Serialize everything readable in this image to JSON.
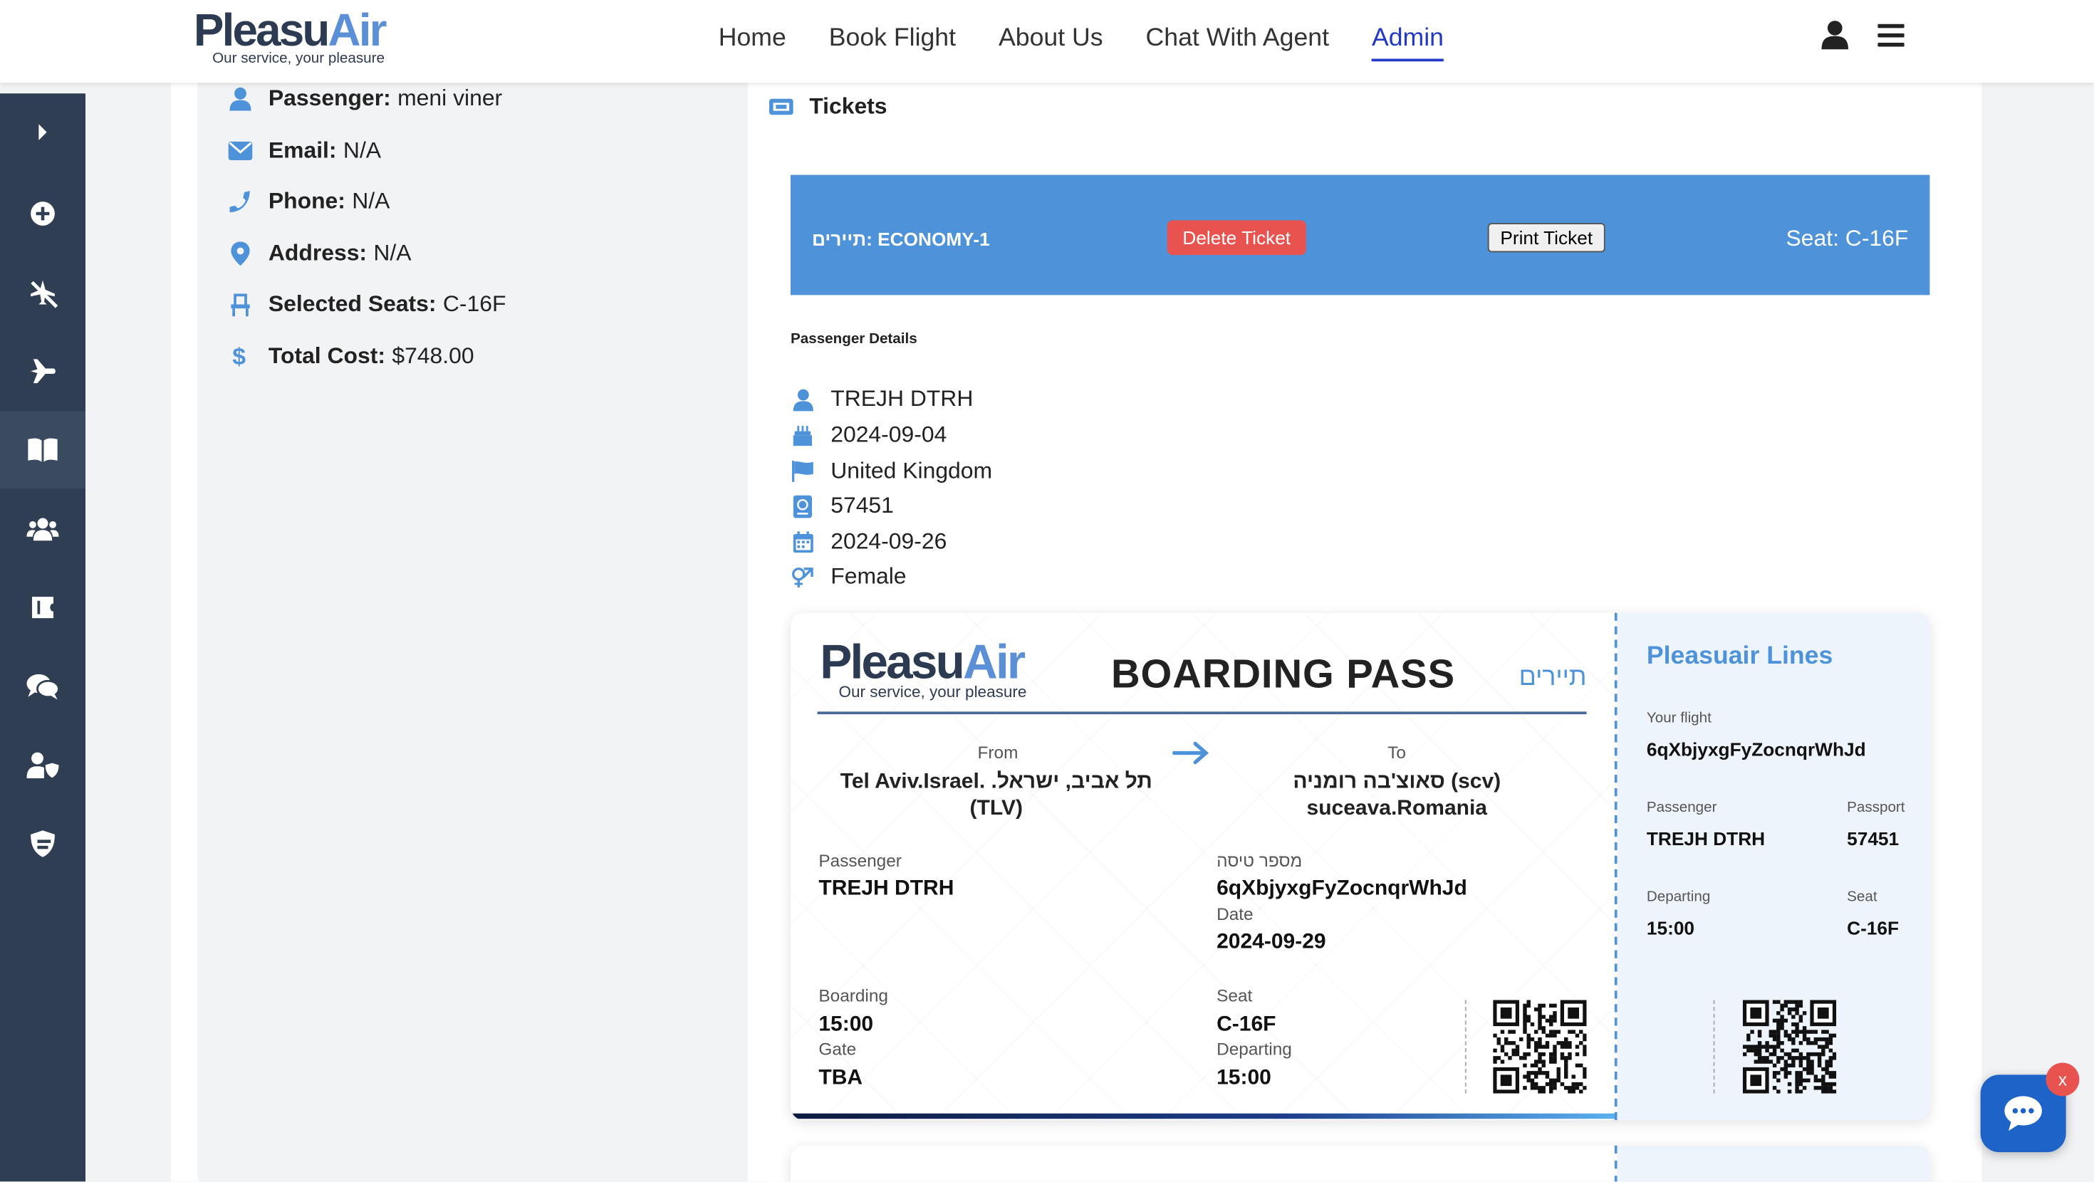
{
  "brand": {
    "name_main": "Pleasu",
    "name_accent": "Air",
    "tagline": "Our service, your pleasure"
  },
  "nav": {
    "items": [
      "Home",
      "Book Flight",
      "About Us",
      "Chat With Agent",
      "Admin"
    ],
    "active": "Admin"
  },
  "booking_info": {
    "passenger_label": "Passenger:",
    "passenger_value": "meni viner",
    "email_label": "Email:",
    "email_value": "N/A",
    "phone_label": "Phone:",
    "phone_value": "N/A",
    "address_label": "Address:",
    "address_value": "N/A",
    "seats_label": "Selected Seats:",
    "seats_value": "C-16F",
    "cost_label": "Total Cost:",
    "cost_value": "$748.00"
  },
  "tickets": {
    "heading": "Tickets",
    "bar": {
      "class_label": "תיירים: ECONOMY-1",
      "delete_label": "Delete Ticket",
      "print_label": "Print Ticket",
      "seat_label": "Seat: C-16F"
    },
    "passenger_details_title": "Passenger Details",
    "passenger_details": {
      "name": "TREJH DTRH",
      "birth_date": "2024-09-04",
      "country": "United Kingdom",
      "passport": "57451",
      "date": "2024-09-26",
      "gender": "Female"
    }
  },
  "boarding_pass": {
    "title": "BOARDING PASS",
    "class_hebrew": "תיירים",
    "from_label": "From",
    "from_city": "תל אביב, ישראל. Tel Aviv.Israel. (TLV)",
    "to_label": "To",
    "to_city": "סאוצ'בה רומניה (scv) suceava.Romania",
    "passenger_label": "Passenger",
    "passenger_value": "TREJH DTRH",
    "flight_no_label": "מספר טיסה",
    "flight_no_value": "6qXbjyxgFyZocnqrWhJd",
    "date_label": "Date",
    "date_value": "2024-09-29",
    "boarding_label": "Boarding",
    "boarding_value": "15:00",
    "gate_label": "Gate",
    "gate_value": "TBA",
    "seat_label": "Seat",
    "seat_value": "C-16F",
    "departing_label": "Departing",
    "departing_value": "15:00"
  },
  "stub": {
    "title": "Pleasuair Lines",
    "flight_label": "Your flight",
    "flight_value": "6qXbjyxgFyZocnqrWhJd",
    "passenger_label": "Passenger",
    "passenger_value": "TREJH DTRH",
    "passport_label": "Passport",
    "passport_value": "57451",
    "departing_label": "Departing",
    "departing_value": "15:00",
    "seat_label": "Seat",
    "seat_value": "C-16F"
  },
  "chat": {
    "close_label": "x"
  },
  "colors": {
    "accent": "#4e93d9",
    "sidebar": "#2f3e52",
    "danger": "#e8534f",
    "nav_active": "#2238c7"
  }
}
